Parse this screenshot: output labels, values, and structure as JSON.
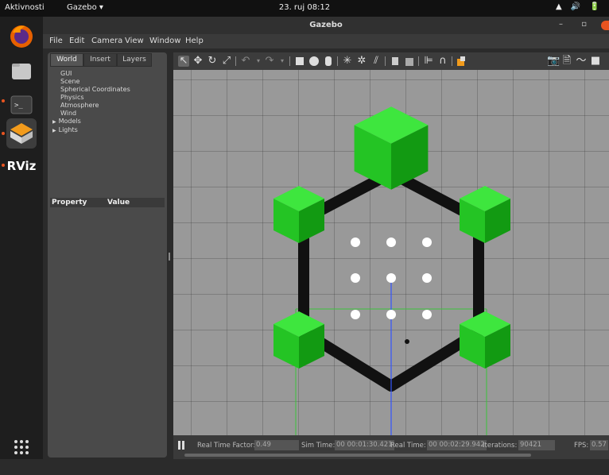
{
  "topbar": {
    "activities": "Aktivnosti",
    "app": "Gazebo ▾",
    "clock": "23. ruj  08:12",
    "tray": "▲ 🔊 🔋"
  },
  "dock": {
    "items": [
      "firefox-icon",
      "files-icon",
      "terminal-icon",
      "gazebo-icon",
      "rviz-icon"
    ],
    "rviz_label": "RViz",
    "apps_grid": "⋮⋮⋮"
  },
  "window": {
    "title": "Gazebo",
    "controls": "– ▫"
  },
  "menu": {
    "items": [
      "File",
      "Edit",
      "Camera",
      "View",
      "Window",
      "Help"
    ]
  },
  "left_panel": {
    "tabs": [
      "World",
      "Insert",
      "Layers"
    ],
    "active_tab": "World",
    "tree": [
      "GUI",
      "Scene",
      "Spherical Coordinates",
      "Physics",
      "Atmosphere",
      "Wind",
      "Models",
      "Lights"
    ],
    "tree_expandable": [
      "Models",
      "Lights"
    ],
    "property_header": "Property",
    "value_header": "Value"
  },
  "status": {
    "real_time_factor_label": "Real Time Factor:",
    "real_time_factor": "0.49",
    "sim_time_label": "Sim Time:",
    "sim_time": "00 00:01:30.421",
    "real_time_label": "Real Time:",
    "real_time": "00 00:02:29.942",
    "iterations_label": "Iterations:",
    "iterations": "90421",
    "fps_label": "FPS:",
    "fps": "0.57"
  },
  "colors": {
    "accent": "#e95420",
    "cube_green": "#22c422",
    "beam": "#111111",
    "ground": "#999999"
  }
}
